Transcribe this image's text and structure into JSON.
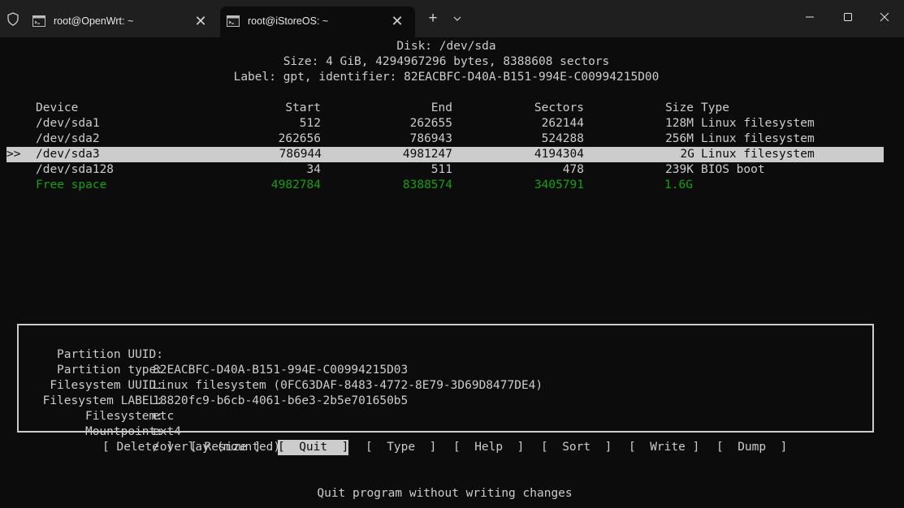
{
  "tabs": [
    {
      "title": "root@OpenWrt: ~",
      "active": false
    },
    {
      "title": "root@iStoreOS: ~",
      "active": true
    }
  ],
  "window": {
    "new_tab_label": "+",
    "close_glyph": "✕"
  },
  "disk": {
    "header": "Disk: /dev/sda",
    "size_line": "Size: 4 GiB, 4294967296 bytes, 8388608 sectors",
    "label_line": "Label: gpt, identifier: 82EACBFC-D40A-B151-994E-C00994215D00"
  },
  "table": {
    "columns": [
      "Device",
      "Start",
      "End",
      "Sectors",
      "Size",
      "Type"
    ],
    "selected_marker": ">>",
    "rows": [
      {
        "device": "/dev/sda1",
        "start": "512",
        "end": "262655",
        "sectors": "262144",
        "size": "128M",
        "type": "Linux filesystem",
        "selected": false
      },
      {
        "device": "/dev/sda2",
        "start": "262656",
        "end": "786943",
        "sectors": "524288",
        "size": "256M",
        "type": "Linux filesystem",
        "selected": false
      },
      {
        "device": "/dev/sda3",
        "start": "786944",
        "end": "4981247",
        "sectors": "4194304",
        "size": "2G",
        "type": "Linux filesystem",
        "selected": true
      },
      {
        "device": "/dev/sda128",
        "start": "34",
        "end": "511",
        "sectors": "478",
        "size": "239K",
        "type": "BIOS boot",
        "selected": false
      },
      {
        "device": "Free space",
        "start": "4982784",
        "end": "8388574",
        "sectors": "3405791",
        "size": "1.6G",
        "type": "",
        "selected": false
      }
    ]
  },
  "details": [
    {
      "key": "Partition UUID:",
      "value": "82EACBFC-D40A-B151-994E-C00994215D03"
    },
    {
      "key": "Partition type:",
      "value": "Linux filesystem (0FC63DAF-8483-4772-8E79-3D69D8477DE4)"
    },
    {
      "key": "Filesystem UUID:",
      "value": "18820fc9-b6cb-4061-b6e3-2b5e701650b5"
    },
    {
      "key": "Filesystem LABEL:",
      "value": "etc"
    },
    {
      "key": "Filesystem:",
      "value": "ext4"
    },
    {
      "key": "Mountpoint:",
      "value": "/overlay (mounted)"
    }
  ],
  "menu": [
    {
      "label": "[ Delete ]",
      "active": false
    },
    {
      "label": "[ Resize ]",
      "active": false
    },
    {
      "label": "[  Quit  ]",
      "active": true
    },
    {
      "label": "[  Type  ]",
      "active": false
    },
    {
      "label": "[  Help  ]",
      "active": false
    },
    {
      "label": "[  Sort  ]",
      "active": false
    },
    {
      "label": "[  Write ]",
      "active": false
    },
    {
      "label": "[  Dump  ]",
      "active": false
    }
  ],
  "hint": "Quit program without writing changes",
  "colors": {
    "terminal_bg": "#0c0c0c",
    "text": "#cccccc",
    "free_space": "#13a10e",
    "selection_bg": "#cccccc"
  }
}
